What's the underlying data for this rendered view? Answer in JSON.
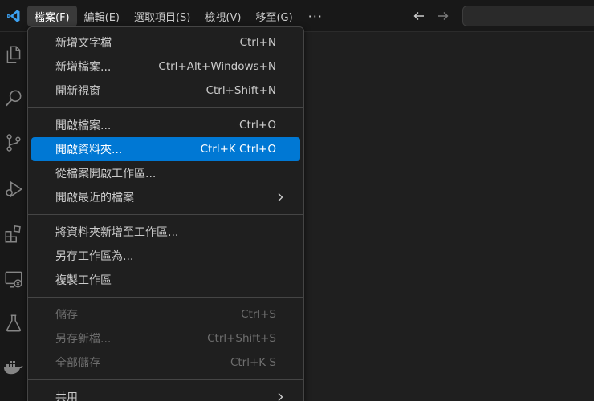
{
  "menubar": {
    "items": [
      "檔案(F)",
      "編輯(E)",
      "選取項目(S)",
      "檢視(V)",
      "移至(G)"
    ],
    "more": "···"
  },
  "file_menu": {
    "group1": [
      {
        "label": "新增文字檔",
        "shortcut": "Ctrl+N"
      },
      {
        "label": "新增檔案...",
        "shortcut": "Ctrl+Alt+Windows+N"
      },
      {
        "label": "開新視窗",
        "shortcut": "Ctrl+Shift+N"
      }
    ],
    "group2": [
      {
        "label": "開啟檔案...",
        "shortcut": "Ctrl+O"
      },
      {
        "label": "開啟資料夾...",
        "shortcut": "Ctrl+K Ctrl+O"
      },
      {
        "label": "從檔案開啟工作區...",
        "shortcut": ""
      },
      {
        "label": "開啟最近的檔案",
        "shortcut": ""
      }
    ],
    "group3": [
      {
        "label": "將資料夾新增至工作區..."
      },
      {
        "label": "另存工作區為..."
      },
      {
        "label": "複製工作區"
      }
    ],
    "group4": [
      {
        "label": "儲存",
        "shortcut": "Ctrl+S"
      },
      {
        "label": "另存新檔...",
        "shortcut": "Ctrl+Shift+S"
      },
      {
        "label": "全部儲存",
        "shortcut": "Ctrl+K S"
      }
    ],
    "group5": [
      {
        "label": "共用"
      }
    ]
  },
  "colors": {
    "accent": "#0078d4",
    "logo": "#3ca0f0",
    "background": "#1f1f1f"
  },
  "icons": [
    "vscode-logo-icon",
    "explorer-icon",
    "search-icon",
    "source-control-icon",
    "run-debug-icon",
    "extensions-icon",
    "remote-explorer-icon",
    "testing-icon",
    "docker-icon",
    "arrow-left-icon",
    "arrow-right-icon",
    "chevron-right-icon"
  ]
}
